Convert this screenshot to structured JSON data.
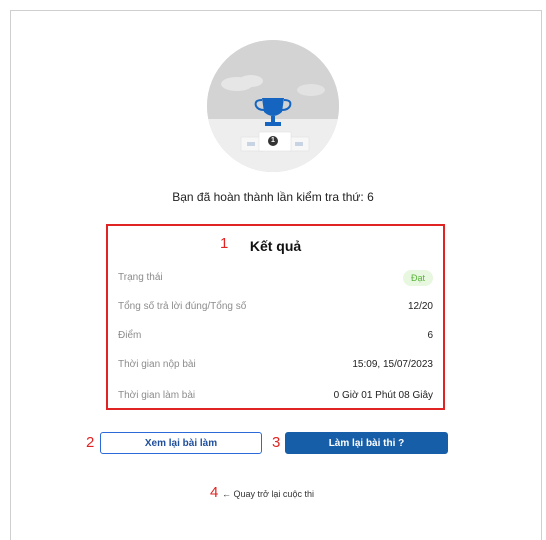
{
  "completion_text": "Bạn đã hoàn thành lần kiểm tra thứ: 6",
  "hero": {
    "icon": "trophy-icon",
    "podium_rank": "1"
  },
  "result": {
    "title": "Kết quả",
    "rows": [
      {
        "label": "Trạng thái",
        "value": "Đạt",
        "kind": "badge"
      },
      {
        "label": "Tổng số trả lời đúng/Tổng số",
        "value": "12/20"
      },
      {
        "label": "Điểm",
        "value": "6"
      },
      {
        "label": "Thời gian nộp bài",
        "value": "15:09, 15/07/2023"
      },
      {
        "label": "Thời gian làm bài",
        "value": "0 Giờ 01 Phút 08 Giây"
      }
    ]
  },
  "buttons": {
    "review_label": "Xem lại bài làm",
    "retake_label": "Làm lại bài thi ?"
  },
  "back_link": {
    "arrow": "←",
    "label": "Quay trở lại cuộc thi"
  },
  "annotations": [
    "1",
    "2",
    "3",
    "4"
  ],
  "colors": {
    "annotation_red": "#e02424",
    "primary_blue": "#175ea8",
    "outline_blue": "#2b6ad8",
    "trophy_blue": "#1565c0",
    "pass_green": "#58b33a",
    "pass_green_bg": "#e8f7df"
  }
}
